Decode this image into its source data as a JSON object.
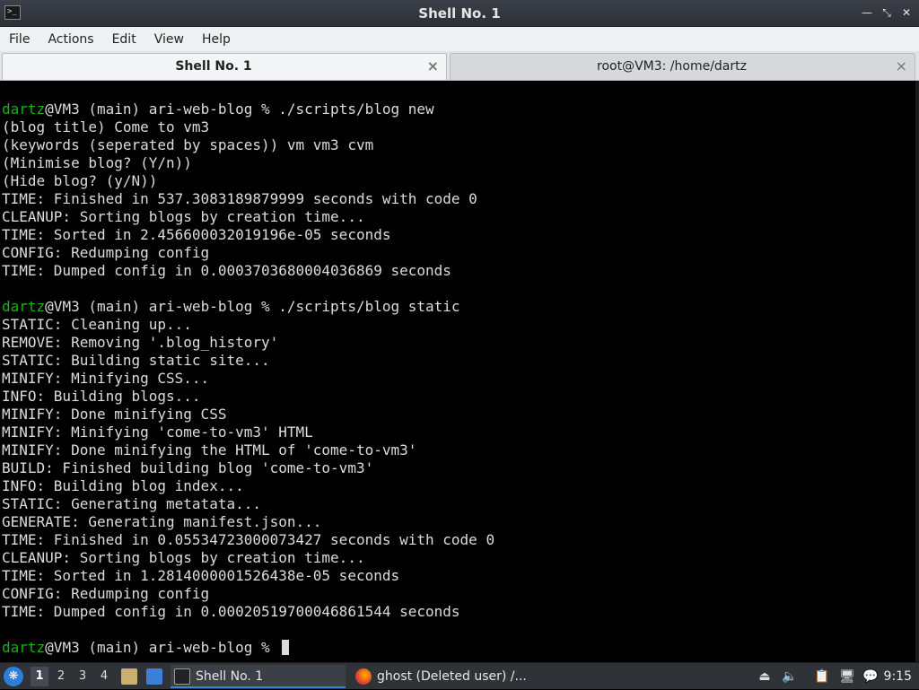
{
  "window": {
    "title": "Shell No. 1",
    "controls": [
      "minimize-icon",
      "restore-icon",
      "close-icon"
    ]
  },
  "menubar": {
    "items": [
      "File",
      "Actions",
      "Edit",
      "View",
      "Help"
    ]
  },
  "tabs": [
    {
      "label": "Shell No. 1",
      "active": true,
      "close": "×"
    },
    {
      "label": "root@VM3: /home/dartz",
      "active": false,
      "close": "×"
    }
  ],
  "terminal": {
    "user_color": "#18b218",
    "lines": [
      {
        "user": "dartz",
        "text": "@VM3 (main) ari-web-blog % ./scripts/blog new"
      },
      {
        "text": "(blog title) Come to vm3"
      },
      {
        "text": "(keywords (seperated by spaces)) vm vm3 cvm"
      },
      {
        "text": "(Minimise blog? (Y/n))"
      },
      {
        "text": "(Hide blog? (y/N))"
      },
      {
        "text": "TIME: Finished in 537.3083189879999 seconds with code 0"
      },
      {
        "text": "CLEANUP: Sorting blogs by creation time..."
      },
      {
        "text": "TIME: Sorted in 2.456600032019196e-05 seconds"
      },
      {
        "text": "CONFIG: Redumping config"
      },
      {
        "text": "TIME: Dumped config in 0.0003703680004036869 seconds"
      },
      {
        "text": ""
      },
      {
        "user": "dartz",
        "text": "@VM3 (main) ari-web-blog % ./scripts/blog static"
      },
      {
        "text": "STATIC: Cleaning up..."
      },
      {
        "text": "REMOVE: Removing '.blog_history'"
      },
      {
        "text": "STATIC: Building static site..."
      },
      {
        "text": "MINIFY: Minifying CSS..."
      },
      {
        "text": "INFO: Building blogs..."
      },
      {
        "text": "MINIFY: Done minifying CSS"
      },
      {
        "text": "MINIFY: Minifying 'come-to-vm3' HTML"
      },
      {
        "text": "MINIFY: Done minifying the HTML of 'come-to-vm3'"
      },
      {
        "text": "BUILD: Finished building blog 'come-to-vm3'"
      },
      {
        "text": "INFO: Building blog index..."
      },
      {
        "text": "STATIC: Generating metatata..."
      },
      {
        "text": "GENERATE: Generating manifest.json..."
      },
      {
        "text": "TIME: Finished in 0.05534723000073427 seconds with code 0"
      },
      {
        "text": "CLEANUP: Sorting blogs by creation time..."
      },
      {
        "text": "TIME: Sorted in 1.2814000001526438e-05 seconds"
      },
      {
        "text": "CONFIG: Redumping config"
      },
      {
        "text": "TIME: Dumped config in 0.00020519700046861544 seconds"
      },
      {
        "text": ""
      },
      {
        "user": "dartz",
        "text": "@VM3 (main) ari-web-blog % ",
        "cursor": true
      }
    ]
  },
  "taskbar": {
    "workspaces": [
      "1",
      "2",
      "3",
      "4"
    ],
    "active_workspace": "1",
    "tasks": [
      {
        "label": "Shell No. 1",
        "icon": "terminal-icon",
        "active": true
      },
      {
        "label": "ghost (Deleted user) /...",
        "icon": "firefox-icon",
        "active": false
      }
    ],
    "tray_icons": [
      "eject-icon",
      "volume-icon",
      "clipboard-icon",
      "network-icon",
      "chat-icon"
    ],
    "clock": "9:15"
  }
}
